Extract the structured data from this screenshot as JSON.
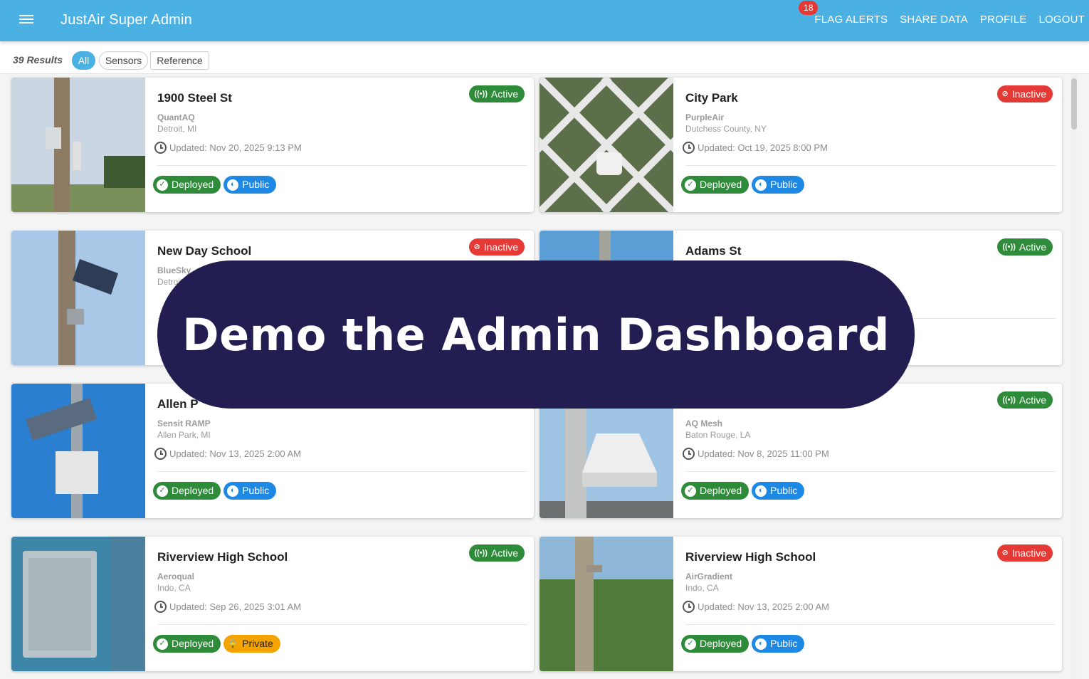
{
  "app": {
    "title": "JustAir Super Admin",
    "nav": [
      "FLAG ALERTS",
      "SHARE DATA",
      "PROFILE",
      "LOGOUT"
    ],
    "flag_count": "18"
  },
  "filters": {
    "results_label": "39 Results",
    "options": [
      "All",
      "Sensors",
      "Reference"
    ],
    "selected": "All"
  },
  "overlay": {
    "text": "Demo the Admin Dashboard"
  },
  "icons": {
    "clock": "clock-icon",
    "check": "check-circle-icon",
    "globe": "globe-icon",
    "lock": "lock-icon",
    "signal": "signal-icon",
    "no-signal": "no-signal-icon"
  },
  "colors": {
    "brand": "#4bb1e3",
    "active": "#2e8b3a",
    "inactive": "#e53935",
    "public": "#1e88e5",
    "private": "#f5a300",
    "overlay": "#221e52"
  },
  "cards": [
    {
      "name": "1900 Steel St",
      "vendor": "QuantAQ",
      "location": "Detroit, MI",
      "updated": "Updated: Nov 20, 2025 9:13 PM",
      "status": "Active",
      "deploy": "Deployed",
      "visibility": "Public"
    },
    {
      "name": "City Park",
      "vendor": "PurpleAir",
      "location": "Dutchess County, NY",
      "updated": "Updated: Oct 19, 2025 8:00 PM",
      "status": "Inactive",
      "deploy": "Deployed",
      "visibility": "Public"
    },
    {
      "name": "New Day School",
      "vendor": "BlueSky",
      "location": "Detroit",
      "updated": "",
      "status": "Inactive",
      "deploy": "",
      "visibility": ""
    },
    {
      "name": "Adams St",
      "vendor": "",
      "location": "",
      "updated": "",
      "status": "Active",
      "deploy": "",
      "visibility": ""
    },
    {
      "name": "Allen P",
      "vendor": "Sensit RAMP",
      "location": "Allen Park, MI",
      "updated": "Updated: Nov 13, 2025 2:00 AM",
      "status": "",
      "deploy": "Deployed",
      "visibility": "Public"
    },
    {
      "name": "",
      "vendor": "AQ Mesh",
      "location": "Baton Rouge, LA",
      "updated": "Updated: Nov 8, 2025 11:00 PM",
      "status": "Active",
      "deploy": "Deployed",
      "visibility": "Public"
    },
    {
      "name": "Riverview High School",
      "vendor": "Aeroqual",
      "location": "Indo, CA",
      "updated": "Updated: Sep 26, 2025 3:01 AM",
      "status": "Active",
      "deploy": "Deployed",
      "visibility": "Private"
    },
    {
      "name": "Riverview High School",
      "vendor": "AirGradient",
      "location": "Indo, CA",
      "updated": "Updated: Nov 13, 2025 2:00 AM",
      "status": "Inactive",
      "deploy": "Deployed",
      "visibility": "Public"
    }
  ]
}
